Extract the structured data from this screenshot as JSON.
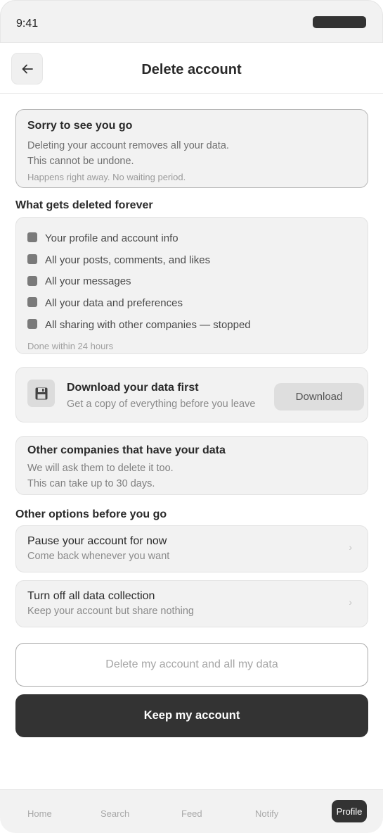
{
  "status": {
    "time": "9:41"
  },
  "header": {
    "title": "Delete account"
  },
  "warning": {
    "title": "Sorry to see you go",
    "lines": [
      "Deleting your account removes all your data.",
      "This cannot be undone."
    ],
    "note": "Happens right away. No waiting period."
  },
  "deleted": {
    "heading": "What gets deleted forever",
    "items": [
      "Your profile and account info",
      "All your posts, comments, and likes",
      "All your messages",
      "All your data and preferences",
      "All sharing with other companies — stopped"
    ],
    "footnote": "Done within 24 hours"
  },
  "download": {
    "icon": "save-icon",
    "title": "Download your data first",
    "subtitle": "Get a copy of everything before you leave",
    "button": "Download"
  },
  "others": {
    "title": "Other companies that have your data",
    "lines": [
      "We will ask them to delete it too.",
      "This can take up to 30 days."
    ]
  },
  "options": {
    "heading": "Other options before you go",
    "items": [
      {
        "title": "Pause your account for now",
        "subtitle": "Come back whenever you want"
      },
      {
        "title": "Turn off all data collection",
        "subtitle": "Keep your account but share nothing"
      }
    ]
  },
  "actions": {
    "delete": "Delete my account and all my data",
    "keep": "Keep my account"
  },
  "tabs": {
    "items": [
      "Home",
      "Search",
      "Feed",
      "Notify"
    ],
    "active": "Profile"
  },
  "colors": {
    "primary": "#333333",
    "card": "#f2f2f2",
    "muted": "#8a8a8a"
  }
}
